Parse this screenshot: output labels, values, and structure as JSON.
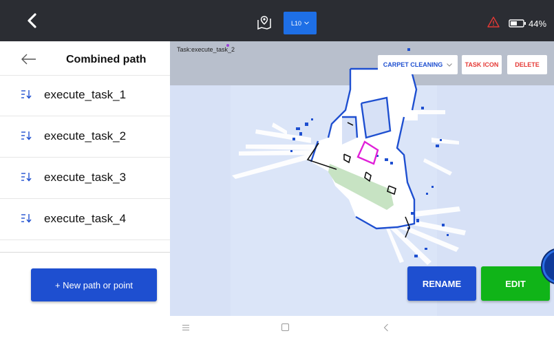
{
  "topbar": {
    "robot_select_label": "L10",
    "battery_text": "44%"
  },
  "sidebar": {
    "title": "Combined path",
    "items": [
      {
        "label": "execute_task_1"
      },
      {
        "label": "execute_task_2"
      },
      {
        "label": "execute_task_3"
      },
      {
        "label": "execute_task_4"
      }
    ],
    "new_button_label": "+ New path or point"
  },
  "map": {
    "task_name": "Task:execute_task_2",
    "carpet_select_value": "CARPET CLEANING",
    "task_icon_label": "TASK ICON",
    "delete_label": "DELETE",
    "rename_label": "RENAME",
    "edit_label": "EDIT"
  },
  "icons": {
    "back": "chevron-left-icon",
    "map": "map-pin-icon",
    "warning": "warning-icon",
    "battery": "battery-icon",
    "sort": "sort-down-icon"
  },
  "colors": {
    "topbar_bg": "#2b2d33",
    "primary_blue": "#1e4fd0",
    "edit_green": "#10b418",
    "danger_red": "#e53935",
    "map_bg": "#d7e1f6",
    "task_path": "#e020d8"
  }
}
